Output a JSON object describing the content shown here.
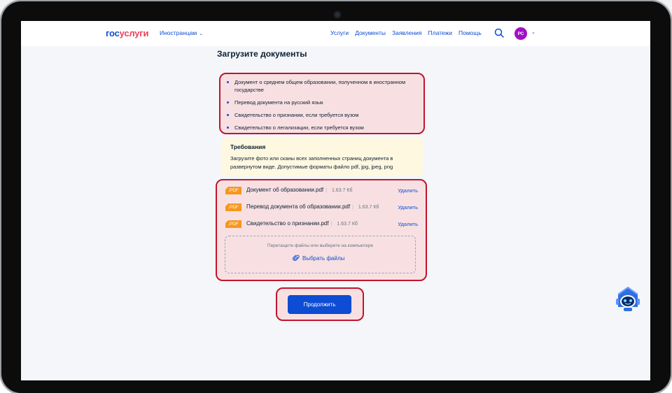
{
  "header": {
    "logo_part1": "гос",
    "logo_part2": "услуги",
    "region": "Иностранцам",
    "nav": [
      "Услуги",
      "Документы",
      "Заявления",
      "Платежи",
      "Помощь"
    ],
    "avatar_initials": "РС"
  },
  "main": {
    "title": "Загрузите документы",
    "documents": [
      "Документ о среднем общем образовании, полученном в иностранном государстве",
      "Перевод документа на русский язык",
      "Свидетельство о признании, если требуется вузом",
      "Свидетельство о легализации, если требуется вузом"
    ],
    "requirements": {
      "title": "Требования",
      "text": "Загрузите фото или сканы всех заполненных страниц документа в развернутом виде. Допустимые форматы файло pdf, jpg, jpeg, png"
    },
    "files": [
      {
        "badge": ".PDF",
        "name": "Документ об образовании.pdf",
        "size": "1.63.7 Кб",
        "action": "Удалить"
      },
      {
        "badge": ".PDF",
        "name": "Перевод документа об образовании.pdf",
        "size": "1.63.7 Кб",
        "action": "Удалить"
      },
      {
        "badge": ".PDF",
        "name": "Свидетельство о признании.pdf",
        "size": "1.63.7 Кб",
        "action": "Удалить"
      }
    ],
    "dropzone": {
      "hint": "Перетащите файлы или выберите на компьютере",
      "button": "Выбрать файлы"
    },
    "continue_label": "Продолжить"
  },
  "colors": {
    "brand_blue": "#0d4cd3",
    "brand_red": "#ee3f58",
    "highlight_border": "#c0152c",
    "pdf_badge": "#f7971d"
  },
  "icons": [
    "search-icon",
    "chevron-down-icon",
    "paperclip-icon",
    "pdf-icon",
    "assistant-robot-icon"
  ]
}
